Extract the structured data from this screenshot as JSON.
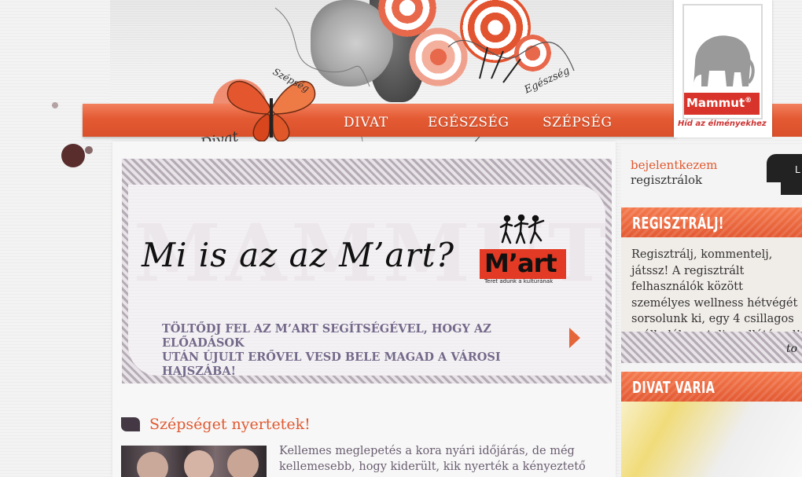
{
  "nav": {
    "items": [
      "DIVAT",
      "EGÉSZSÉG",
      "SZÉPSÉG"
    ]
  },
  "header": {
    "scribbles": [
      "Divat",
      "Szépség",
      "Egészség"
    ]
  },
  "logo": {
    "brand": "Mammut",
    "registered": "®",
    "tagline": "Híd az élményekhez"
  },
  "banner": {
    "watermark": "MAMMUT",
    "title": "Mi is az az M’art?",
    "subtitle_line1": "TÖLTŐDJ FEL AZ M’ART SEGÍTSÉGÉVEL, HOGY AZ ELŐADÁSOK",
    "subtitle_line2": "UTÁN ÚJULT ERŐVEL VESD BELE MAGAD A VÁROSI HAJSZÁBA!",
    "mart_logo_text": "M’art",
    "mart_tagline": "Teret adunk a kultúrának"
  },
  "article": {
    "title": "Szépséget nyertetek!",
    "text": "Kellemes meglepetés a kora nyári időjárás, de még kellemesebb, hogy kiderült, kik nyerték a kényeztető"
  },
  "sidebar": {
    "login": "bejelentkezem",
    "register": "regisztrálok",
    "login_button": "L",
    "register_box": {
      "title": "REGISZTRÁLJ!",
      "text": "Regisztrálj, kommentelj, játssz! A regisztrált felhasználók között személyes wellness hétvégét sorsolunk ki, egy 4 csillagos szállodában, teljes ellátással!",
      "footer": "to"
    },
    "divat_box": {
      "title": "DIVAT VARIA"
    }
  },
  "colors": {
    "accent": "#e35a33",
    "heading": "#e0582f",
    "muted_text": "#73698a",
    "logo_red": "#d9342b"
  }
}
